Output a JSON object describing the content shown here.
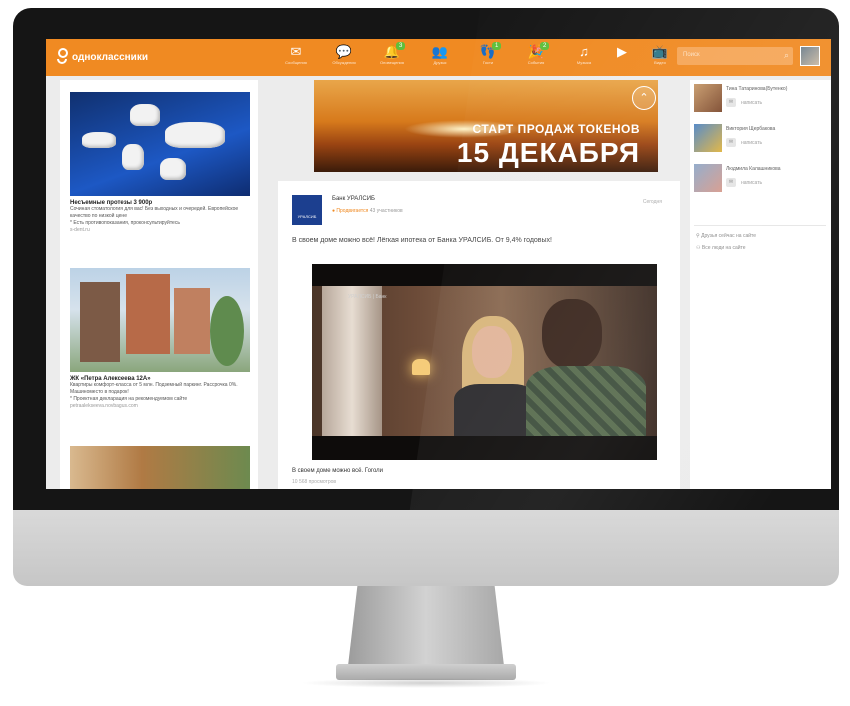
{
  "site": {
    "name": "одноклассники"
  },
  "nav": [
    {
      "icon": "envelope-icon",
      "glyph": "✉",
      "label": "Сообщения",
      "badge": ""
    },
    {
      "icon": "chat-icon",
      "glyph": "💬",
      "label": "Обсуждения",
      "badge": ""
    },
    {
      "icon": "bell-icon",
      "glyph": "🔔",
      "label": "Оповещения",
      "badge": "3"
    },
    {
      "icon": "friends-icon",
      "glyph": "👥",
      "label": "Друзья",
      "badge": ""
    },
    {
      "icon": "guests-icon",
      "glyph": "👣",
      "label": "Гости",
      "badge": "1"
    },
    {
      "icon": "events-icon",
      "glyph": "🎉",
      "label": "События",
      "badge": "2"
    },
    {
      "icon": "music-icon",
      "glyph": "♫",
      "label": "Музыка",
      "badge": ""
    },
    {
      "icon": "video-icon",
      "glyph": "▶",
      "label": "",
      "badge": ""
    },
    {
      "icon": "tv-icon",
      "glyph": "📺",
      "label": "Видео",
      "badge": ""
    }
  ],
  "search": {
    "placeholder": "Поиск"
  },
  "ads": [
    {
      "title": "Несъемные протезы 3 900р",
      "text": "Сочиная стоматология для вас! Без выходных и очередей. Европейское качество по низкой цене",
      "note": "* Есть противопоказания, проконсультируйтесь",
      "link": "s-dent.ru"
    },
    {
      "title": "ЖК «Петра Алексеева 12А»",
      "text": "Квартиры комфорт-класса от 5 млн. Подземный паркинг. Рассрочка 0%. Машиноместо в подарок!",
      "note": "* Проектная декларация на рекомендуемом сайте",
      "link": "petraalekseeva.novbagus.com"
    }
  ],
  "banner": {
    "line1": "СТАРТ ПРОДАЖ ТОКЕНОВ",
    "line2": "15 ДЕКАБРЯ",
    "up": "⌃"
  },
  "post": {
    "logo": "УРАЛСИБ",
    "author": "Банк УРАЛСИБ",
    "promo": "● Продвигается",
    "participants": "43 участников",
    "time": "Сегодня",
    "text": "В своем доме можно всё! Лёгкая ипотека от Банка УРАЛСИБ. От 9,4% годовых!",
    "video_brand": "УРАЛСИБ | Банк",
    "caption": "В своем доме можно всё. Гоголи",
    "views": "10 568 просмотров"
  },
  "friends": [
    {
      "name": "Тина Татаринова(Бутенко)",
      "write": "написать"
    },
    {
      "name": "Виктория Щербакова",
      "write": "написать"
    },
    {
      "name": "Людмила Калашникова",
      "write": "написать"
    }
  ],
  "links": {
    "friends_online": "Друзья сейчас на сайте",
    "all_online": "Все люди на сайте"
  },
  "colors": {
    "brand": "#f08a22",
    "badge": "#5fbf3b"
  }
}
